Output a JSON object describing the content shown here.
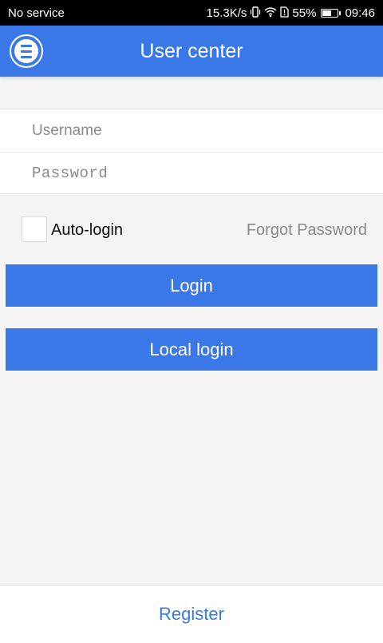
{
  "status_bar": {
    "carrier": "No service",
    "net_speed": "15.3K/s",
    "battery": "55%",
    "battery_level": 0.55,
    "time": "09:46",
    "icons": [
      "vibrate-icon",
      "wifi-icon",
      "sim-icon",
      "battery-icon"
    ]
  },
  "app_bar": {
    "title": "User center",
    "menu_icon": "menu-icon"
  },
  "form": {
    "username_placeholder": "Username",
    "username_value": "",
    "password_placeholder": "Password",
    "password_value": "",
    "auto_login_label": "Auto-login",
    "auto_login_checked": false,
    "forgot_password": "Forgot Password"
  },
  "buttons": {
    "login": "Login",
    "local_login": "Local login"
  },
  "footer": {
    "register": "Register"
  },
  "colors": {
    "accent": "#3b78e7",
    "background": "#f4f4f4",
    "status_bar": "#000000"
  }
}
